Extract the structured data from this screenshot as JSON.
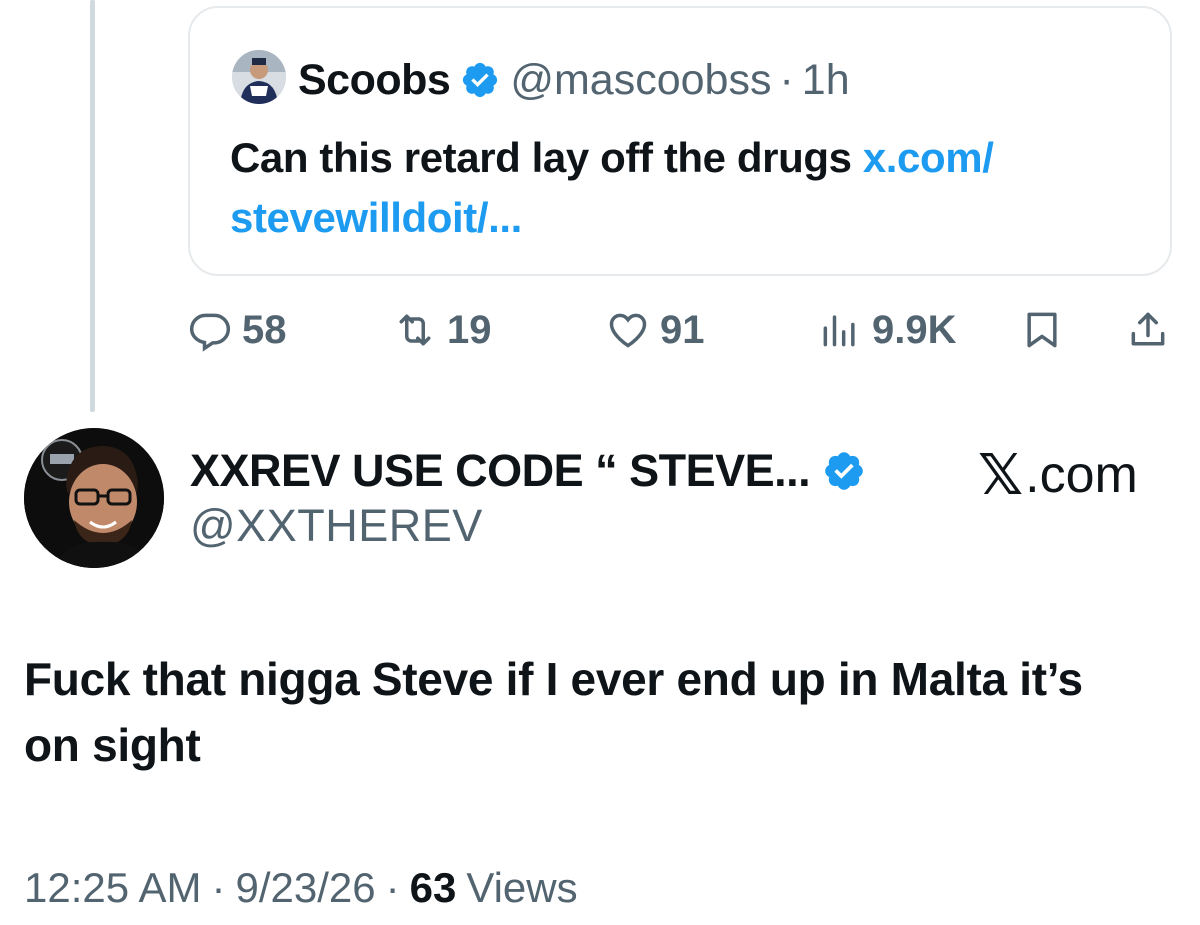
{
  "quoted_tweet": {
    "author_name": "Scoobs",
    "handle": "@mascoobss",
    "separator": "·",
    "time": "1h",
    "text": "Can this retard lay off the drugs ",
    "link_text": "x.com/ stevewilldoit/..."
  },
  "actions": {
    "replies": "58",
    "reposts": "19",
    "likes": "91",
    "views": "9.9K"
  },
  "tweet": {
    "author_name": "XXREV USE CODE “ STEVE...",
    "handle": "@XXTHEREV",
    "brand_mark": "𝕏",
    "brand_suffix": ".com",
    "text": "Fuck that nigga Steve if I ever end up in Malta it’s on sight",
    "time": "12:25 AM",
    "date": "9/23/26",
    "separator": "·",
    "views_count": "63",
    "views_label": "Views"
  },
  "colors": {
    "accent": "#1d9bf0",
    "text_primary": "#0f1419",
    "text_secondary": "#536471",
    "border": "#e6eaed"
  }
}
